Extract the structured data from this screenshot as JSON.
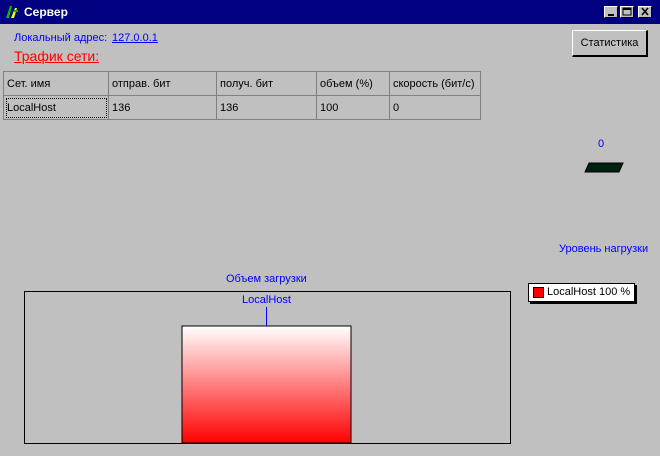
{
  "window": {
    "title": "Сервер"
  },
  "header": {
    "local_address_label": "Локальный адрес:",
    "local_address_value": "127.0.0.1",
    "traffic_title": "Трафик сети:",
    "statistics_button": "Статистика"
  },
  "table": {
    "columns": [
      "Сет. имя",
      "отправ. бит",
      "получ. бит",
      "объем (%)",
      "скорость (бит/с)"
    ],
    "rows": [
      [
        "LocalHost",
        "136",
        "136",
        "100",
        "0"
      ]
    ]
  },
  "gauge": {
    "value": "0",
    "label": "Уровень нагрузки"
  },
  "chart_data": {
    "type": "bar",
    "title": "Объем загрузки",
    "categories": [
      "LocalHost"
    ],
    "values": [
      100
    ],
    "ylim": [
      0,
      100
    ],
    "colors": {
      "bar_top": "#ffffff",
      "bar_bottom": "#ff0000"
    }
  },
  "legend": {
    "entry": "LocalHost 100 %",
    "color": "#ff0000"
  }
}
